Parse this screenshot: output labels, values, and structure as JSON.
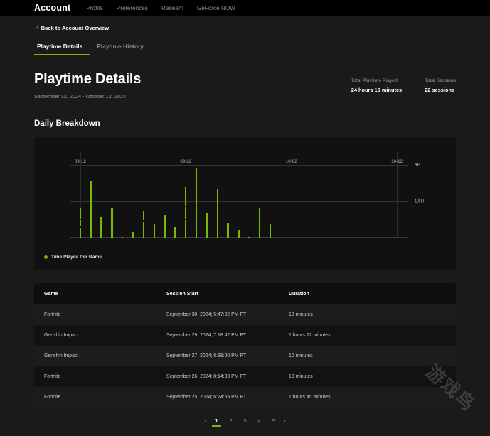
{
  "topnav": {
    "brand": "Account",
    "links": [
      {
        "label": "Profile"
      },
      {
        "label": "Preferences"
      },
      {
        "label": "Redeem"
      },
      {
        "label": "GeForce NOW"
      }
    ]
  },
  "back": {
    "chevron": "‹",
    "label": "Back to Account Overview"
  },
  "tabs": [
    {
      "label": "Playtime Details",
      "active": true
    },
    {
      "label": "Playtime History",
      "active": false
    }
  ],
  "header": {
    "title": "Playtime Details",
    "date_range": "September 12, 2024 - October 12, 2024"
  },
  "stats": [
    {
      "label": "Total Playtime Played",
      "value": "24 hours 19 minutes"
    },
    {
      "label": "Total Sessions",
      "value": "22 sessions"
    }
  ],
  "section": {
    "heading": "Daily Breakdown"
  },
  "chart_data": {
    "type": "bar",
    "title": "Daily Breakdown",
    "xlabel": "",
    "ylabel": "",
    "ylim": [
      0,
      3.6
    ],
    "grid": true,
    "legend_position": "bottom-left",
    "series": [
      {
        "name": "Time Played Per Game",
        "color": "#76b900"
      }
    ],
    "y_ticks": [
      {
        "value": 3.0,
        "label": "3H"
      },
      {
        "value": 1.5,
        "label": "1.5H"
      }
    ],
    "x_ticks": [
      {
        "value": 0,
        "label": "09-12"
      },
      {
        "value": 10,
        "label": "09-22"
      },
      {
        "value": 20,
        "label": "10-02"
      },
      {
        "value": 30,
        "label": "10-12"
      }
    ],
    "x_unit": "day index from 09-12",
    "categories": [
      "09-12",
      "09-13",
      "09-14",
      "09-15",
      "09-16",
      "09-17",
      "09-18",
      "09-19",
      "09-20",
      "09-21",
      "09-22",
      "09-23",
      "09-24",
      "09-25",
      "09-26",
      "09-27",
      "09-28",
      "09-29",
      "09-30",
      "10-01",
      "10-02",
      "10-03",
      "10-04",
      "10-05",
      "10-06",
      "10-07",
      "10-08",
      "10-09",
      "10-10",
      "10-11",
      "10-12"
    ],
    "values": [
      1.2,
      2.35,
      0.85,
      1.25,
      0.03,
      0.25,
      1.1,
      0.55,
      0.95,
      0.45,
      2.1,
      2.9,
      1.0,
      2.0,
      0.6,
      0.3,
      0.03,
      1.2,
      0.55,
      0,
      0,
      0,
      0,
      0,
      0,
      0,
      0,
      0,
      0,
      0,
      0
    ],
    "segmented_bars": [
      0,
      6,
      10
    ]
  },
  "legend": {
    "label": "Time Played Per Game"
  },
  "table": {
    "columns": [
      "Game",
      "Session Start",
      "Duration"
    ],
    "rows": [
      {
        "game": "Fortnite",
        "start": "September 30, 2024; 5:47:32 PM PT",
        "duration": "18 minutes"
      },
      {
        "game": "Genshin Impact",
        "start": "September 29, 2024; 7:18:42 PM PT",
        "duration": "1 hours 12 minutes"
      },
      {
        "game": "Genshin Impact",
        "start": "September 27, 2024; 8:38:20 PM PT",
        "duration": "10 minutes"
      },
      {
        "game": "Fortnite",
        "start": "September 26, 2024; 8:14:39 PM PT",
        "duration": "19 minutes"
      },
      {
        "game": "Fortnite",
        "start": "September 25, 2024; 6:24:55 PM PT",
        "duration": "1 hours 45 minutes"
      }
    ]
  },
  "pagination": {
    "prev": "‹",
    "next": "›",
    "pages": [
      "1",
      "2",
      "3",
      "4",
      "5"
    ],
    "current": "1"
  },
  "watermark": {
    "text": "游戏鸟"
  },
  "colors": {
    "accent": "#76b900",
    "background": "#1a1a1a",
    "nav_background": "#000000",
    "card_background": "#111111"
  }
}
